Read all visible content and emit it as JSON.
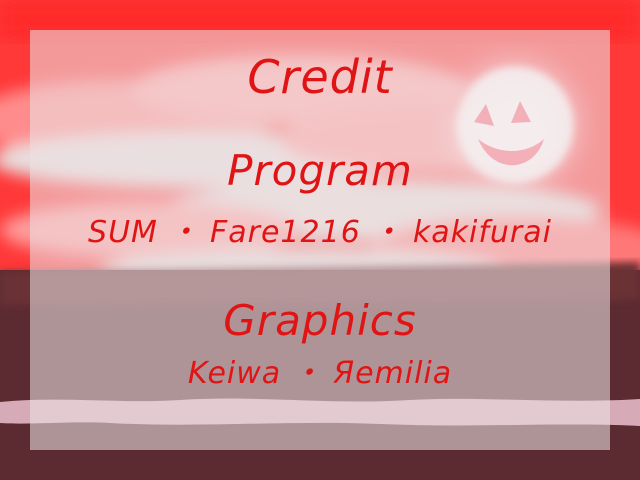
{
  "credits": {
    "title": "Credit",
    "sections": [
      {
        "heading": "Program",
        "names": "SUM ・ Fare1216 ・ kakifurai"
      },
      {
        "heading": "Graphics",
        "names": "Keiwa ・ Яemilia"
      }
    ]
  },
  "colors": {
    "text": "#e01414",
    "sky": "#ff3b3b",
    "ground": "#5a2a30",
    "panel": "#ece0e2"
  },
  "icons": {
    "moon": "smiling-moon-icon"
  }
}
